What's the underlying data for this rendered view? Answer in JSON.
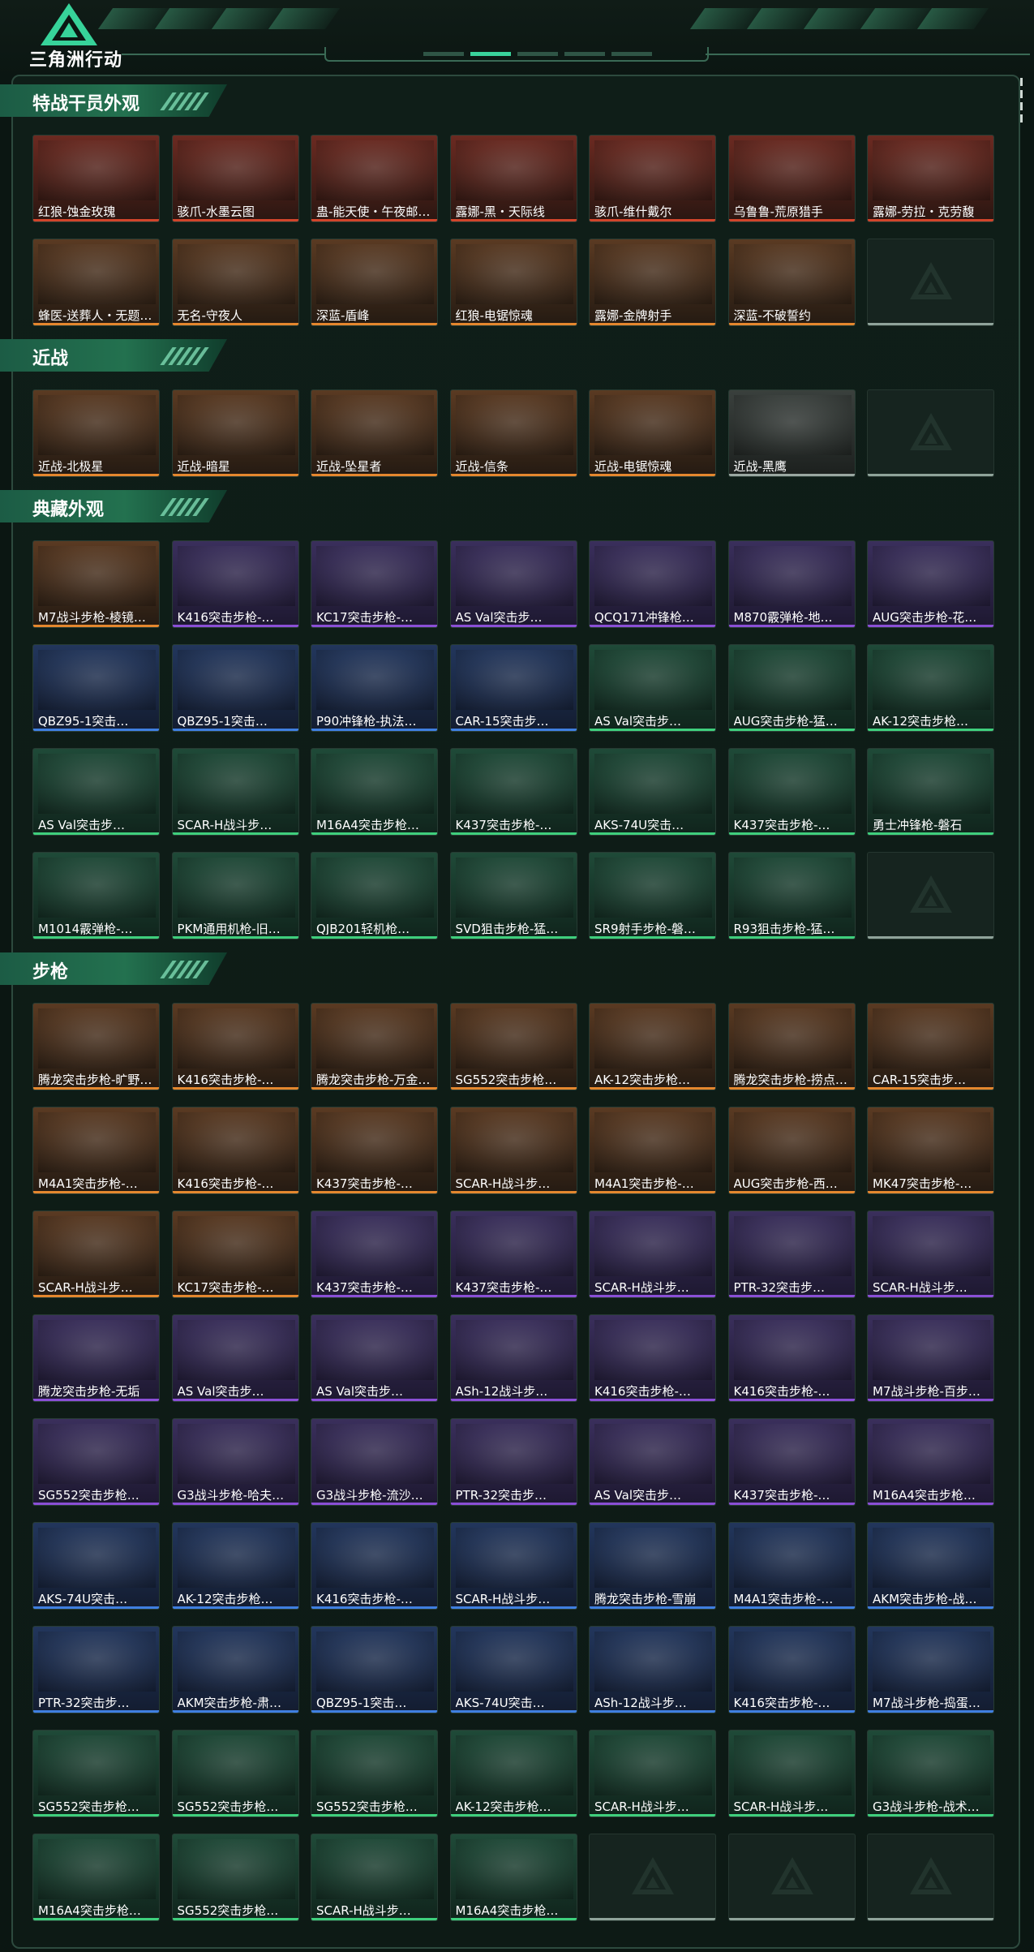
{
  "app": {
    "title": "三角洲行动"
  },
  "header": {
    "active_page": 2,
    "page_count": 5
  },
  "sections": [
    {
      "title": "特战干员外观",
      "items": [
        {
          "label": "红狼-蚀金玫瑰",
          "rarity": "red"
        },
        {
          "label": "骇爪-水墨云图",
          "rarity": "red"
        },
        {
          "label": "蛊-能天使・午夜邮…",
          "rarity": "red"
        },
        {
          "label": "露娜-黑・天际线",
          "rarity": "red"
        },
        {
          "label": "骇爪-维什戴尔",
          "rarity": "red"
        },
        {
          "label": "乌鲁鲁-荒原猎手",
          "rarity": "red"
        },
        {
          "label": "露娜-劳拉・克劳馥",
          "rarity": "red"
        },
        {
          "label": "蜂医-送葬人・无题…",
          "rarity": "orange"
        },
        {
          "label": "无名-守夜人",
          "rarity": "orange"
        },
        {
          "label": "深蓝-盾峰",
          "rarity": "orange"
        },
        {
          "label": "红狼-电锯惊魂",
          "rarity": "orange"
        },
        {
          "label": "露娜-金牌射手",
          "rarity": "orange"
        },
        {
          "label": "深蓝-不破誓约",
          "rarity": "orange"
        },
        {
          "empty": true
        }
      ]
    },
    {
      "title": "近战",
      "items": [
        {
          "label": "近战-北极星",
          "rarity": "orange"
        },
        {
          "label": "近战-暗星",
          "rarity": "orange"
        },
        {
          "label": "近战-坠星者",
          "rarity": "orange"
        },
        {
          "label": "近战-信条",
          "rarity": "orange"
        },
        {
          "label": "近战-电锯惊魂",
          "rarity": "orange"
        },
        {
          "label": "近战-黑鹰",
          "rarity": "grey"
        },
        {
          "empty": true
        }
      ]
    },
    {
      "title": "典藏外观",
      "items": [
        {
          "label": "M7战斗步枪-棱镜…",
          "rarity": "orange"
        },
        {
          "label": "K416突击步枪-…",
          "rarity": "purple"
        },
        {
          "label": "KC17突击步枪-…",
          "rarity": "purple"
        },
        {
          "label": "AS Val突击步…",
          "rarity": "purple"
        },
        {
          "label": "QCQ171冲锋枪…",
          "rarity": "purple"
        },
        {
          "label": "M870霰弹枪-地…",
          "rarity": "purple"
        },
        {
          "label": "AUG突击步枪-花…",
          "rarity": "purple"
        },
        {
          "label": "QBZ95-1突击…",
          "rarity": "blue"
        },
        {
          "label": "QBZ95-1突击…",
          "rarity": "blue"
        },
        {
          "label": "P90冲锋枪-执法…",
          "rarity": "blue"
        },
        {
          "label": "CAR-15突击步…",
          "rarity": "blue"
        },
        {
          "label": "AS Val突击步…",
          "rarity": "green"
        },
        {
          "label": "AUG突击步枪-猛…",
          "rarity": "green"
        },
        {
          "label": "AK-12突击步枪…",
          "rarity": "green"
        },
        {
          "label": "AS Val突击步…",
          "rarity": "green"
        },
        {
          "label": "SCAR-H战斗步…",
          "rarity": "green"
        },
        {
          "label": "M16A4突击步枪…",
          "rarity": "green"
        },
        {
          "label": "K437突击步枪-…",
          "rarity": "green"
        },
        {
          "label": "AKS-74U突击…",
          "rarity": "green"
        },
        {
          "label": "K437突击步枪-…",
          "rarity": "green"
        },
        {
          "label": "勇士冲锋枪-磐石",
          "rarity": "green"
        },
        {
          "label": "M1014霰弹枪-…",
          "rarity": "green"
        },
        {
          "label": "PKM通用机枪-旧…",
          "rarity": "green"
        },
        {
          "label": "QJB201轻机枪…",
          "rarity": "green"
        },
        {
          "label": "SVD狙击步枪-猛…",
          "rarity": "green"
        },
        {
          "label": "SR9射手步枪-磐…",
          "rarity": "green"
        },
        {
          "label": "R93狙击步枪-猛…",
          "rarity": "green"
        },
        {
          "empty": true
        }
      ]
    },
    {
      "title": "步枪",
      "items": [
        {
          "label": "腾龙突击步枪-旷野…",
          "rarity": "orange"
        },
        {
          "label": "K416突击步枪-…",
          "rarity": "orange"
        },
        {
          "label": "腾龙突击步枪-万金…",
          "rarity": "orange"
        },
        {
          "label": "SG552突击步枪…",
          "rarity": "orange"
        },
        {
          "label": "AK-12突击步枪…",
          "rarity": "orange"
        },
        {
          "label": "腾龙突击步枪-捞点…",
          "rarity": "orange"
        },
        {
          "label": "CAR-15突击步…",
          "rarity": "orange"
        },
        {
          "label": "M4A1突击步枪-…",
          "rarity": "orange"
        },
        {
          "label": "K416突击步枪-…",
          "rarity": "orange"
        },
        {
          "label": "K437突击步枪-…",
          "rarity": "orange"
        },
        {
          "label": "SCAR-H战斗步…",
          "rarity": "orange"
        },
        {
          "label": "M4A1突击步枪-…",
          "rarity": "orange"
        },
        {
          "label": "AUG突击步枪-西…",
          "rarity": "orange"
        },
        {
          "label": "MK47突击步枪-…",
          "rarity": "orange"
        },
        {
          "label": "SCAR-H战斗步…",
          "rarity": "orange"
        },
        {
          "label": "KC17突击步枪-…",
          "rarity": "orange"
        },
        {
          "label": "K437突击步枪-…",
          "rarity": "purple"
        },
        {
          "label": "K437突击步枪-…",
          "rarity": "purple"
        },
        {
          "label": "SCAR-H战斗步…",
          "rarity": "purple"
        },
        {
          "label": "PTR-32突击步…",
          "rarity": "purple"
        },
        {
          "label": "SCAR-H战斗步…",
          "rarity": "purple"
        },
        {
          "label": "腾龙突击步枪-无垢",
          "rarity": "purple"
        },
        {
          "label": "AS Val突击步…",
          "rarity": "purple"
        },
        {
          "label": "AS Val突击步…",
          "rarity": "purple"
        },
        {
          "label": "ASh-12战斗步…",
          "rarity": "purple"
        },
        {
          "label": "K416突击步枪-…",
          "rarity": "purple"
        },
        {
          "label": "K416突击步枪-…",
          "rarity": "purple"
        },
        {
          "label": "M7战斗步枪-百步…",
          "rarity": "purple"
        },
        {
          "label": "SG552突击步枪…",
          "rarity": "purple"
        },
        {
          "label": "G3战斗步枪-哈夫…",
          "rarity": "purple"
        },
        {
          "label": "G3战斗步枪-流沙…",
          "rarity": "purple"
        },
        {
          "label": "PTR-32突击步…",
          "rarity": "purple"
        },
        {
          "label": "AS Val突击步…",
          "rarity": "purple"
        },
        {
          "label": "K437突击步枪-…",
          "rarity": "purple"
        },
        {
          "label": "M16A4突击步枪…",
          "rarity": "purple"
        },
        {
          "label": "AKS-74U突击…",
          "rarity": "blue"
        },
        {
          "label": "AK-12突击步枪…",
          "rarity": "blue"
        },
        {
          "label": "K416突击步枪-…",
          "rarity": "blue"
        },
        {
          "label": "SCAR-H战斗步…",
          "rarity": "blue"
        },
        {
          "label": "腾龙突击步枪-雪崩",
          "rarity": "blue"
        },
        {
          "label": "M4A1突击步枪-…",
          "rarity": "blue"
        },
        {
          "label": "AKM突击步枪-战…",
          "rarity": "blue"
        },
        {
          "label": "PTR-32突击步…",
          "rarity": "blue"
        },
        {
          "label": "AKM突击步枪-肃…",
          "rarity": "blue"
        },
        {
          "label": "QBZ95-1突击…",
          "rarity": "blue"
        },
        {
          "label": "AKS-74U突击…",
          "rarity": "blue"
        },
        {
          "label": "ASh-12战斗步…",
          "rarity": "blue"
        },
        {
          "label": "K416突击步枪-…",
          "rarity": "blue"
        },
        {
          "label": "M7战斗步枪-捣蛋…",
          "rarity": "blue"
        },
        {
          "label": "SG552突击步枪…",
          "rarity": "green"
        },
        {
          "label": "SG552突击步枪…",
          "rarity": "green"
        },
        {
          "label": "SG552突击步枪…",
          "rarity": "green"
        },
        {
          "label": "AK-12突击步枪…",
          "rarity": "green"
        },
        {
          "label": "SCAR-H战斗步…",
          "rarity": "green"
        },
        {
          "label": "SCAR-H战斗步…",
          "rarity": "green"
        },
        {
          "label": "G3战斗步枪-战术…",
          "rarity": "green"
        },
        {
          "label": "M16A4突击步枪…",
          "rarity": "green"
        },
        {
          "label": "SG552突击步枪…",
          "rarity": "green"
        },
        {
          "label": "SCAR-H战斗步…",
          "rarity": "green"
        },
        {
          "label": "M16A4突击步枪…",
          "rarity": "green"
        },
        {
          "empty": true
        },
        {
          "empty": true
        },
        {
          "empty": true
        }
      ]
    }
  ],
  "colors": {
    "background": "#0b1612",
    "accent": "#39d39b",
    "red": "#d2452b",
    "orange": "#e4872e",
    "purple": "#8a4fd6",
    "blue": "#3f7fe0",
    "green": "#3fcf7d",
    "grey": "#9aa7a1"
  }
}
